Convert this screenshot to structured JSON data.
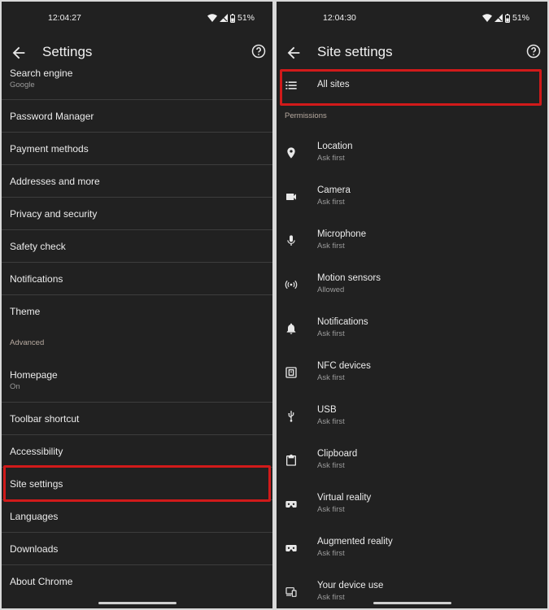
{
  "left": {
    "status": {
      "time": "12:04:27",
      "battery": "51%"
    },
    "header": {
      "title": "Settings"
    },
    "search_engine": {
      "label": "Search engine",
      "value": "Google"
    },
    "items": [
      {
        "label": "Password Manager"
      },
      {
        "label": "Payment methods"
      },
      {
        "label": "Addresses and more"
      },
      {
        "label": "Privacy and security"
      },
      {
        "label": "Safety check"
      },
      {
        "label": "Notifications"
      },
      {
        "label": "Theme"
      }
    ],
    "advanced_label": "Advanced",
    "homepage": {
      "label": "Homepage",
      "value": "On"
    },
    "items2": [
      {
        "label": "Toolbar shortcut"
      },
      {
        "label": "Accessibility"
      },
      {
        "label": "Site settings"
      },
      {
        "label": "Languages"
      },
      {
        "label": "Downloads"
      },
      {
        "label": "About Chrome"
      }
    ]
  },
  "right": {
    "status": {
      "time": "12:04:30",
      "battery": "51%"
    },
    "header": {
      "title": "Site settings"
    },
    "all_sites": {
      "label": "All sites"
    },
    "permissions_label": "Permissions",
    "permissions": [
      {
        "label": "Location",
        "value": "Ask first",
        "icon": "location-icon"
      },
      {
        "label": "Camera",
        "value": "Ask first",
        "icon": "camera-icon"
      },
      {
        "label": "Microphone",
        "value": "Ask first",
        "icon": "microphone-icon"
      },
      {
        "label": "Motion sensors",
        "value": "Allowed",
        "icon": "motion-sensors-icon"
      },
      {
        "label": "Notifications",
        "value": "Ask first",
        "icon": "bell-icon"
      },
      {
        "label": "NFC devices",
        "value": "Ask first",
        "icon": "nfc-icon"
      },
      {
        "label": "USB",
        "value": "Ask first",
        "icon": "usb-icon"
      },
      {
        "label": "Clipboard",
        "value": "Ask first",
        "icon": "clipboard-icon"
      },
      {
        "label": "Virtual reality",
        "value": "Ask first",
        "icon": "vr-headset-icon"
      },
      {
        "label": "Augmented reality",
        "value": "Ask first",
        "icon": "ar-headset-icon"
      },
      {
        "label": "Your device use",
        "value": "Ask first",
        "icon": "device-use-icon"
      }
    ]
  },
  "colors": {
    "background": "#212121",
    "highlight": "#d11a1a",
    "divider": "#3d3d3d"
  }
}
